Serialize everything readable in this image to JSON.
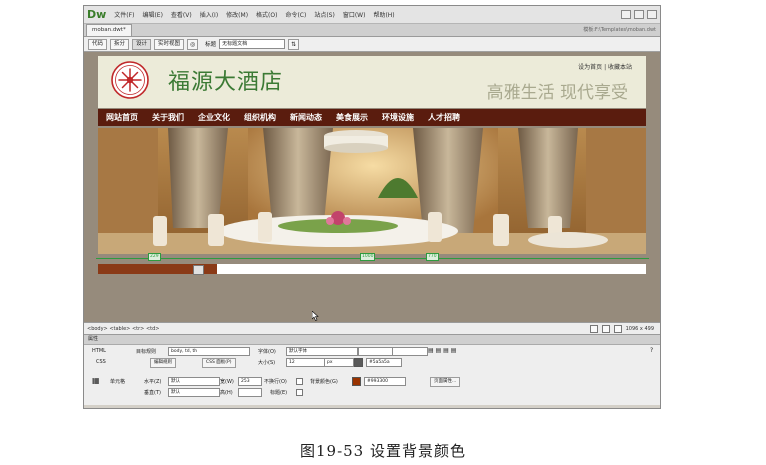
{
  "menubar": {
    "logo": "Dw",
    "items": [
      "文件(F)",
      "编辑(E)",
      "查看(V)",
      "插入(I)",
      "修改(M)",
      "格式(O)",
      "命令(C)",
      "站点(S)",
      "窗口(W)",
      "帮助(H)"
    ]
  },
  "tabs": {
    "doc_tab": "moban.dwt*",
    "path": "模板:F:\\Templates\\moban.dwt"
  },
  "toolbar": {
    "code": "代码",
    "split": "拆分",
    "design": "设计",
    "live": "实时视图",
    "title_label": "标题",
    "title_value": "无标题文档"
  },
  "site": {
    "name": "福源大酒店",
    "top_links": "设为首页 | 收藏本站",
    "slogan": "高雅生活  现代享受",
    "nav": [
      "网站首页",
      "关于我们",
      "企业文化",
      "组织机构",
      "新闻动态",
      "美食展示",
      "环境设施",
      "人才招聘"
    ],
    "colors": {
      "header_bg": "#ecebd9",
      "nav_bg": "#5a1c0e",
      "name": "#3b7a34",
      "slogan": "#a9a98f"
    }
  },
  "guides": {
    "left": "229",
    "middle": "1000",
    "right": "770"
  },
  "statusbar": {
    "tag_path": "<body> <table> <tr> <td>",
    "size": "1096 x 499"
  },
  "properties": {
    "panel_title": "属性",
    "html_tab": "HTML",
    "css_tab": "CSS",
    "target_rule_label": "目标规则",
    "target_rule_value": "body, td, th",
    "edit_rule": "编辑规则",
    "css_panel": "CSS 面板(P)",
    "font_label": "字体(O)",
    "font_value": "默认字体",
    "size_label": "大小(S)",
    "size_value": "12",
    "size_unit": "px",
    "color_value": "#5a5a5a",
    "cell_label": "单元格",
    "horz_label": "水平(Z)",
    "horz_value": "默认",
    "vert_label": "垂直(T)",
    "vert_value": "默认",
    "width_label": "宽(W)",
    "width_value": "253",
    "height_label": "高(H)",
    "nowrap_label": "不换行(O)",
    "header_label": "标题(E)",
    "bg_label": "背景颜色(G)",
    "bg_value": "#993300",
    "bg_color": "#993300",
    "page_props": "页面属性..."
  },
  "caption": "图19-53 设置背景颜色"
}
